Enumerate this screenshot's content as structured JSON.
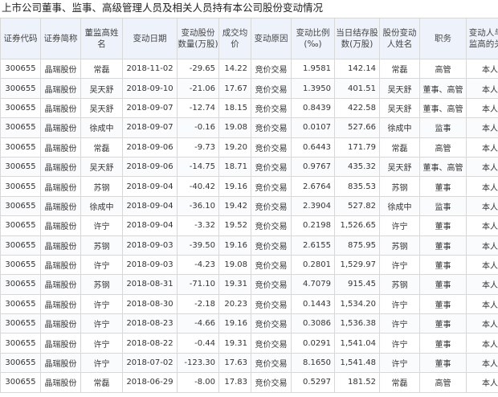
{
  "title": "上市公司董事、监事、高级管理人员及相关人员持有本公司股份变动情况",
  "columns": [
    "证券代码",
    "证券简称",
    "董监高姓名",
    "变动日期",
    "变动股份数量(万股)",
    "成交均价",
    "变动原因",
    "变动比例(‰)",
    "当日结存股数(万股)",
    "股份变动人姓名",
    "职务",
    "变动人与董监高的关系"
  ],
  "rows": [
    [
      "300655",
      "晶瑞股份",
      "常磊",
      "2018-11-02",
      "-29.65",
      "14.22",
      "竞价交易",
      "1.9581",
      "142.14",
      "常磊",
      "高管",
      "本人"
    ],
    [
      "300655",
      "晶瑞股份",
      "吴天舒",
      "2018-09-10",
      "-21.06",
      "17.67",
      "竞价交易",
      "1.3950",
      "401.51",
      "吴天舒",
      "董事、高管",
      "本人"
    ],
    [
      "300655",
      "晶瑞股份",
      "吴天舒",
      "2018-09-07",
      "-12.74",
      "18.15",
      "竞价交易",
      "0.8439",
      "422.58",
      "吴天舒",
      "董事、高管",
      "本人"
    ],
    [
      "300655",
      "晶瑞股份",
      "徐成中",
      "2018-09-07",
      "-0.16",
      "19.08",
      "竞价交易",
      "0.0107",
      "527.66",
      "徐成中",
      "监事",
      "本人"
    ],
    [
      "300655",
      "晶瑞股份",
      "常磊",
      "2018-09-06",
      "-9.73",
      "19.20",
      "竞价交易",
      "0.6443",
      "171.79",
      "常磊",
      "高管",
      "本人"
    ],
    [
      "300655",
      "晶瑞股份",
      "吴天舒",
      "2018-09-06",
      "-14.75",
      "18.71",
      "竞价交易",
      "0.9767",
      "435.32",
      "吴天舒",
      "董事、高管",
      "本人"
    ],
    [
      "300655",
      "晶瑞股份",
      "苏钢",
      "2018-09-04",
      "-40.42",
      "19.16",
      "竞价交易",
      "2.6764",
      "835.53",
      "苏钢",
      "董事",
      "本人"
    ],
    [
      "300655",
      "晶瑞股份",
      "徐成中",
      "2018-09-04",
      "-36.10",
      "19.42",
      "竞价交易",
      "2.3904",
      "527.82",
      "徐成中",
      "监事",
      "本人"
    ],
    [
      "300655",
      "晶瑞股份",
      "许宁",
      "2018-09-04",
      "-3.32",
      "19.52",
      "竞价交易",
      "0.2198",
      "1,526.65",
      "许宁",
      "董事",
      "本人"
    ],
    [
      "300655",
      "晶瑞股份",
      "苏钢",
      "2018-09-03",
      "-39.50",
      "19.16",
      "竞价交易",
      "2.6155",
      "875.95",
      "苏钢",
      "董事",
      "本人"
    ],
    [
      "300655",
      "晶瑞股份",
      "许宁",
      "2018-09-03",
      "-4.23",
      "19.08",
      "竞价交易",
      "0.2801",
      "1,529.97",
      "许宁",
      "董事",
      "本人"
    ],
    [
      "300655",
      "晶瑞股份",
      "苏钢",
      "2018-08-31",
      "-71.10",
      "19.31",
      "竞价交易",
      "4.7079",
      "915.45",
      "苏钢",
      "董事",
      "本人"
    ],
    [
      "300655",
      "晶瑞股份",
      "许宁",
      "2018-08-30",
      "-2.18",
      "20.23",
      "竞价交易",
      "0.1443",
      "1,534.20",
      "许宁",
      "董事",
      "本人"
    ],
    [
      "300655",
      "晶瑞股份",
      "许宁",
      "2018-08-23",
      "-4.66",
      "19.16",
      "竞价交易",
      "0.3086",
      "1,536.38",
      "许宁",
      "董事",
      "本人"
    ],
    [
      "300655",
      "晶瑞股份",
      "许宁",
      "2018-08-22",
      "-0.44",
      "19.31",
      "竞价交易",
      "0.0291",
      "1,541.04",
      "许宁",
      "董事",
      "本人"
    ],
    [
      "300655",
      "晶瑞股份",
      "许宁",
      "2018-07-02",
      "-123.30",
      "17.63",
      "竞价交易",
      "8.1650",
      "1,541.48",
      "许宁",
      "董事",
      "本人"
    ],
    [
      "300655",
      "晶瑞股份",
      "常磊",
      "2018-06-29",
      "-8.00",
      "17.83",
      "竞价交易",
      "0.5297",
      "181.52",
      "常磊",
      "高管",
      "本人"
    ]
  ]
}
